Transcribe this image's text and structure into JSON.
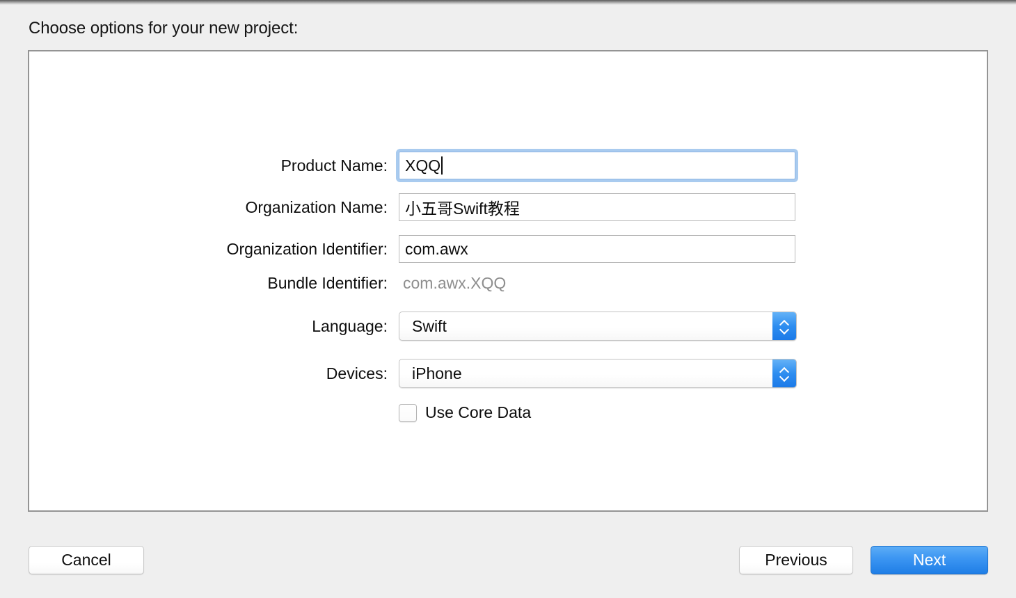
{
  "dialog": {
    "title": "Choose options for your new project:"
  },
  "form": {
    "fields": [
      {
        "label": "Product Name:",
        "value": "XQQ",
        "placeholder": "",
        "type": "textfield-focused"
      },
      {
        "label": "Organization Name:",
        "value": "小五哥Swift教程",
        "placeholder": "",
        "type": "textfield"
      },
      {
        "label": "Organization Identifier:",
        "value": "com.awx",
        "placeholder": "",
        "type": "textfield"
      },
      {
        "label": "Bundle Identifier:",
        "value": "com.awx.XQQ",
        "type": "static"
      },
      {
        "label": "Language:",
        "value": "Swift",
        "type": "popup"
      },
      {
        "label": "Devices:",
        "value": "iPhone",
        "type": "popup"
      }
    ],
    "checkbox": {
      "label": "Use Core Data",
      "checked": false
    }
  },
  "buttons": {
    "cancel": "Cancel",
    "previous": "Previous",
    "next": "Next"
  },
  "icons": {
    "popup_up": "chevron-up-icon",
    "popup_down": "chevron-down-icon"
  },
  "colors": {
    "accent_blue": "#3b95f2",
    "focus_ring": "#a9cbef",
    "popup_arrow_blue": "#2e8ef0",
    "static_text_gray": "#8e8e8e",
    "window_bg": "#efefef",
    "box_border": "#949494"
  }
}
